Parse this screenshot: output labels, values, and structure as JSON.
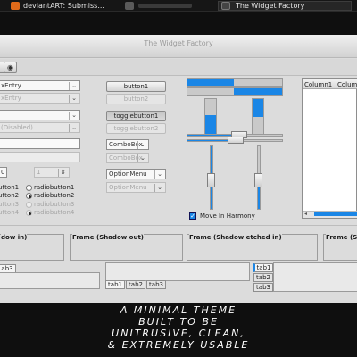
{
  "taskbar": {
    "tabs": [
      {
        "label": "deviantART: Submiss...",
        "icon": "browser-icon",
        "color": "#e06a1a"
      },
      {
        "label": "",
        "icon": "app-icon",
        "color": "#5a5a5a"
      },
      {
        "label": "The Widget Factory",
        "icon": "window-icon",
        "color": "#3a3a3a"
      }
    ]
  },
  "window": {
    "title": "The Widget Factory"
  },
  "toolbar": {
    "button_1": "",
    "button_2": ""
  },
  "left": {
    "combo_entry": "xEntry",
    "combo_entry_disabled": "xEntry",
    "combo_2": "",
    "combo_disabled": "(Disabled)",
    "spin_left": "0",
    "spin_right": "1",
    "radios": [
      {
        "label": "utton1",
        "checked": false,
        "disabled": false
      },
      {
        "label": "radiobutton1",
        "checked": false,
        "disabled": false
      },
      {
        "label": "utton2",
        "checked": false,
        "disabled": false
      },
      {
        "label": "radiobutton2",
        "checked": true,
        "disabled": false
      },
      {
        "label": "utton3",
        "checked": false,
        "disabled": true
      },
      {
        "label": "radiobutton3",
        "checked": false,
        "disabled": true
      },
      {
        "label": "utton4",
        "checked": false,
        "disabled": true
      },
      {
        "label": "radiobutton4",
        "checked": true,
        "disabled": true
      }
    ]
  },
  "middle": {
    "button1": "button1",
    "button2": "button2",
    "togglebutton1": "togglebutton1",
    "togglebutton2": "togglebutton2",
    "combobox": "ComboBox",
    "combobox_disabled": "ComboBox",
    "optionmenu": "OptionMenu",
    "optionmenu_disabled": "OptionMenu"
  },
  "right": {
    "move_in_harmony": "Move In Harmony",
    "move_in_harmony_checked": true,
    "treeview_column1": "Column1",
    "treeview_column2": "Colum",
    "accent_color": "#1a86e6"
  },
  "frames": [
    {
      "label": "dow in)"
    },
    {
      "label": "Frame (Shadow out)"
    },
    {
      "label": "Frame (Shadow etched in)"
    },
    {
      "label": "Frame (S"
    }
  ],
  "tabs": {
    "group1": [
      "ab3"
    ],
    "group2": [
      "tab1",
      "tab2",
      "tab3"
    ],
    "group3": [
      "tab1",
      "tab2",
      "tab3"
    ]
  },
  "tagline": {
    "line1": "A minimal theme",
    "line2": "built to be",
    "line3": "unitrusive, clean,",
    "line4": "& extremely usable"
  }
}
